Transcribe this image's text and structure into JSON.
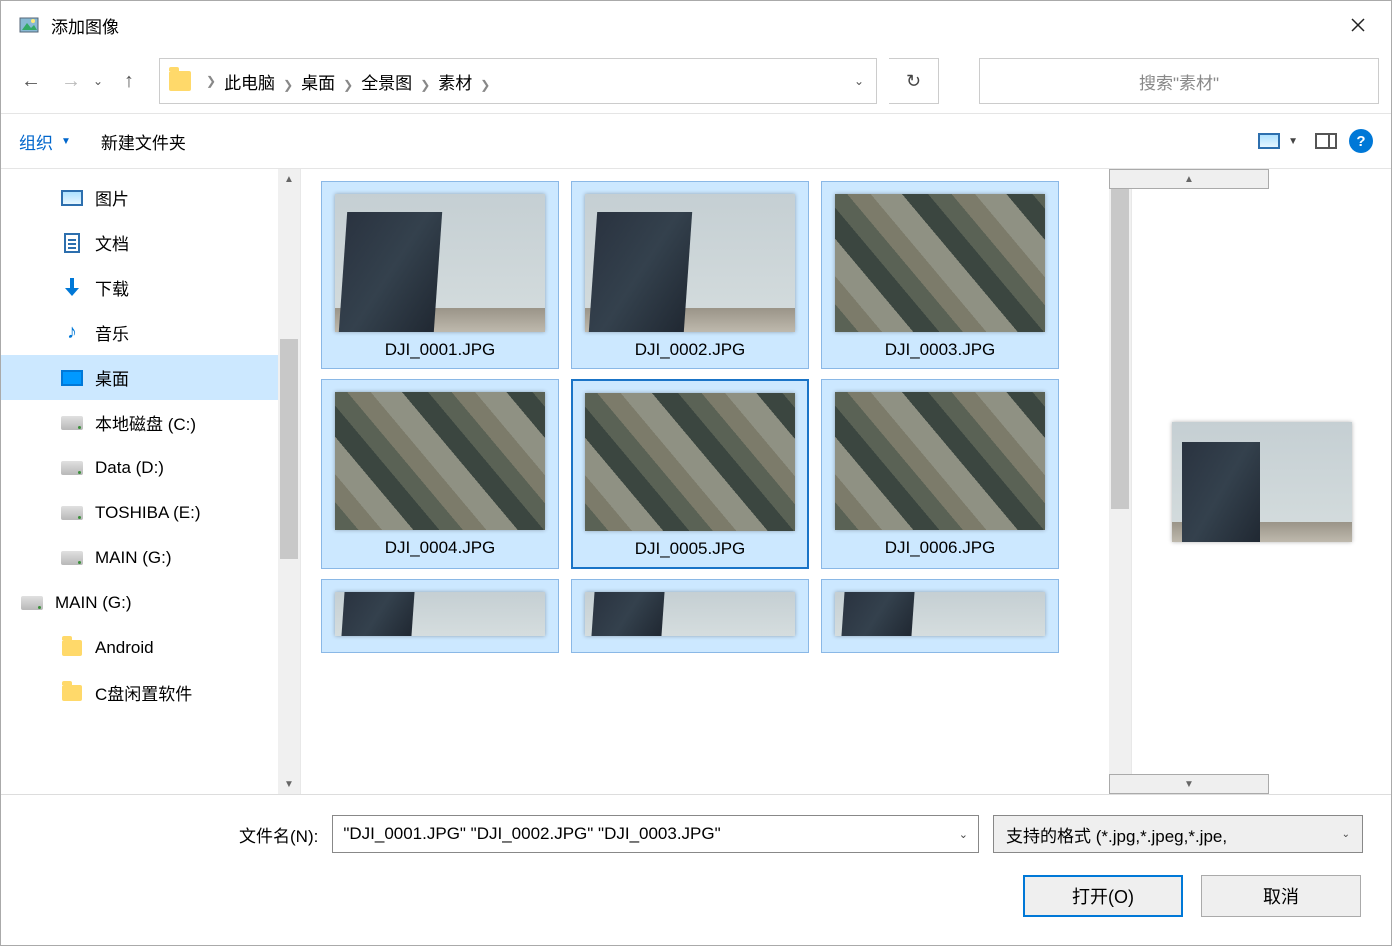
{
  "title": "添加图像",
  "nav": {
    "back_enabled": false,
    "forward_enabled": false
  },
  "breadcrumbs": [
    "此电脑",
    "桌面",
    "全景图",
    "素材"
  ],
  "search_placeholder": "搜索\"素材\"",
  "toolbar": {
    "organize": "组织",
    "new_folder": "新建文件夹"
  },
  "sidebar": [
    {
      "icon": "pictures",
      "label": "图片",
      "level": 1
    },
    {
      "icon": "doc",
      "label": "文档",
      "level": 1
    },
    {
      "icon": "download",
      "label": "下载",
      "level": 1
    },
    {
      "icon": "music",
      "label": "音乐",
      "level": 1
    },
    {
      "icon": "desktop",
      "label": "桌面",
      "level": 1,
      "active": true
    },
    {
      "icon": "drive",
      "label": "本地磁盘 (C:)",
      "level": 1
    },
    {
      "icon": "drive",
      "label": "Data (D:)",
      "level": 1
    },
    {
      "icon": "drive",
      "label": "TOSHIBA (E:)",
      "level": 1
    },
    {
      "icon": "drive",
      "label": "MAIN (G:)",
      "level": 1
    },
    {
      "icon": "drive",
      "label": "MAIN (G:)",
      "level": 0
    },
    {
      "icon": "folder",
      "label": "Android",
      "level": 1
    },
    {
      "icon": "folder",
      "label": "C盘闲置软件",
      "level": 1
    }
  ],
  "files": [
    {
      "name": "DJI_0001.JPG",
      "kind": "building",
      "selected": "selected"
    },
    {
      "name": "DJI_0002.JPG",
      "kind": "building",
      "selected": "selected"
    },
    {
      "name": "DJI_0003.JPG",
      "kind": "aerial",
      "selected": "selected"
    },
    {
      "name": "DJI_0004.JPG",
      "kind": "aerial",
      "selected": "selected"
    },
    {
      "name": "DJI_0005.JPG",
      "kind": "aerial",
      "selected": "selected-focus"
    },
    {
      "name": "DJI_0006.JPG",
      "kind": "aerial",
      "selected": "selected"
    }
  ],
  "filename_label": "文件名(N):",
  "filename_value": "\"DJI_0001.JPG\" \"DJI_0002.JPG\" \"DJI_0003.JPG\"",
  "filetype_value": "支持的格式 (*.jpg,*.jpeg,*.jpe,",
  "buttons": {
    "open": "打开(O)",
    "cancel": "取消"
  }
}
